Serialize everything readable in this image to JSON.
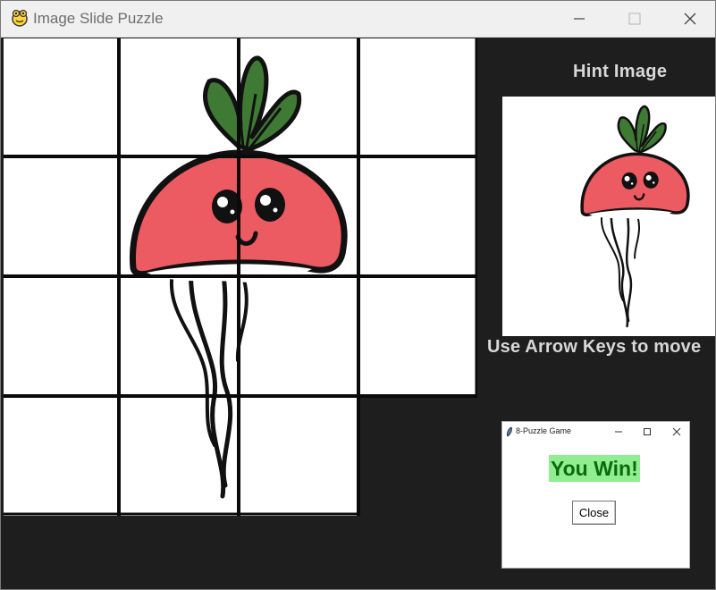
{
  "window": {
    "title": "Image Slide Puzzle",
    "icon": "python-icon",
    "controls": [
      "minimize",
      "maximize",
      "close"
    ]
  },
  "puzzle": {
    "rows": 4,
    "cols": 4,
    "empty_cells": [
      "row 4, col 4"
    ],
    "image": "radish"
  },
  "hint": {
    "label": "Hint Image",
    "image": "radish"
  },
  "instructions": "Use Arrow Keys to move",
  "dialog": {
    "title": "8-Puzzle Game",
    "icon": "feather-icon",
    "message": "You Win!",
    "close_label": "Close",
    "message_bg": "#90ee90",
    "message_color": "#0b6b0b"
  },
  "colors": {
    "background": "#1e1e1e",
    "label_text": "#d8d8d8",
    "radish_red": "#ec5a62",
    "leaf_green": "#3f7a34"
  }
}
